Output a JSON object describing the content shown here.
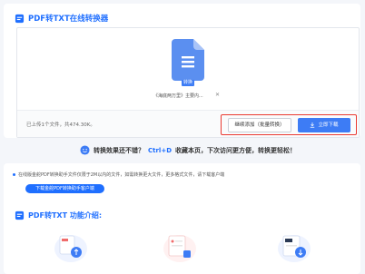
{
  "header": {
    "title": "PDF转TXT在线转换器"
  },
  "file": {
    "icon_name": "txt-file-icon",
    "badge": "转换",
    "name": "《海底两万里》主要内...",
    "delete_icon": "close-icon"
  },
  "footer": {
    "summary": "已上传1个文件，共474.30K。",
    "continue_label": "继续添加（批量转换）",
    "download_label": "立即下载"
  },
  "tip": {
    "lead": "转换效果还不错？",
    "shortcut": "Ctrl+D",
    "rest": "收藏本页，下次访问更方便，转换更轻松！"
  },
  "notice": {
    "text": "在线版金舵PDF转换助手文件仅限于2M以内的文件，如需转换更大文件，更多格式文件，请下载客户端",
    "button_label": "下载金舵PDF转换助手客户端"
  },
  "features": {
    "title": "PDF转TXT 功能介绍:"
  },
  "colors": {
    "accent": "#1f6fff",
    "button": "#3d7cf5",
    "highlight": "#ea3a32"
  }
}
